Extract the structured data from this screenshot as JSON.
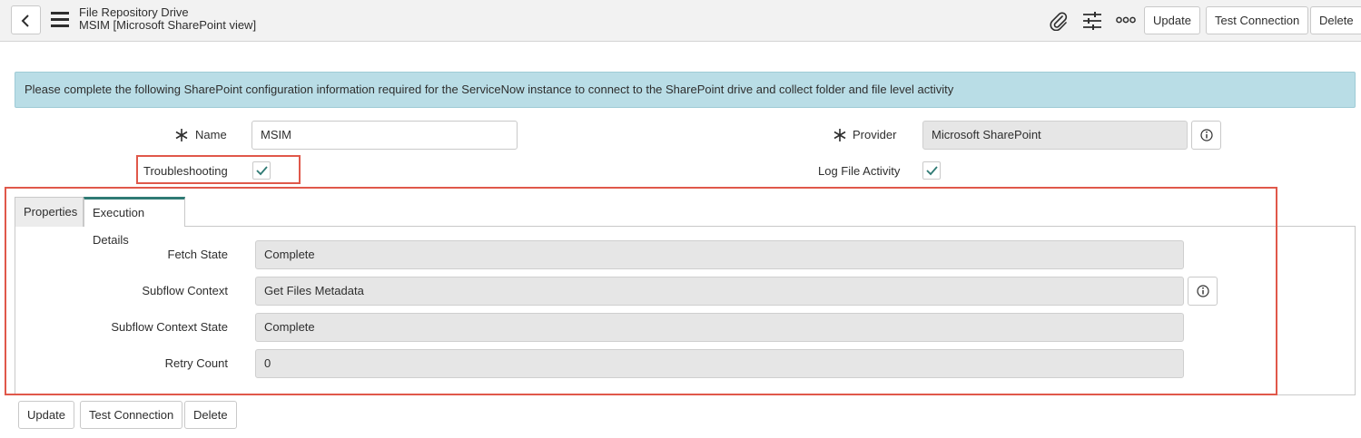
{
  "header": {
    "title": "File Repository Drive",
    "subtitle": "MSIM [Microsoft SharePoint view]",
    "buttons": {
      "update": "Update",
      "test_connection": "Test Connection",
      "delete": "Delete"
    },
    "icons": [
      "back-icon",
      "menu-icon",
      "attachment-icon",
      "settings-sliders-icon",
      "more-options-icon"
    ]
  },
  "banner": {
    "text": "Please complete the following SharePoint configuration information required for the ServiceNow instance to connect to the SharePoint drive and collect folder and file level activity"
  },
  "form": {
    "name": {
      "label": "Name",
      "value": "MSIM",
      "required": true
    },
    "provider": {
      "label": "Provider",
      "value": "Microsoft SharePoint",
      "required": true
    },
    "troubleshooting": {
      "label": "Troubleshooting",
      "checked": true
    },
    "log_file_activity": {
      "label": "Log File Activity",
      "checked": true
    }
  },
  "tabs": [
    {
      "label": "Properties",
      "active": false
    },
    {
      "label": "Execution Details",
      "active": true
    }
  ],
  "execution_details": {
    "fetch_state": {
      "label": "Fetch State",
      "value": "Complete"
    },
    "subflow_context": {
      "label": "Subflow Context",
      "value": "Get Files Metadata"
    },
    "subflow_context_state": {
      "label": "Subflow Context State",
      "value": "Complete"
    },
    "retry_count": {
      "label": "Retry Count",
      "value": "0"
    }
  },
  "footer": {
    "buttons": {
      "update": "Update",
      "test_connection": "Test Connection",
      "delete": "Delete"
    }
  },
  "colors": {
    "banner": "#b9dde6",
    "active_tab": "#2f7a74",
    "check": "#2f7a74",
    "highlight_box": "#e0584a"
  }
}
